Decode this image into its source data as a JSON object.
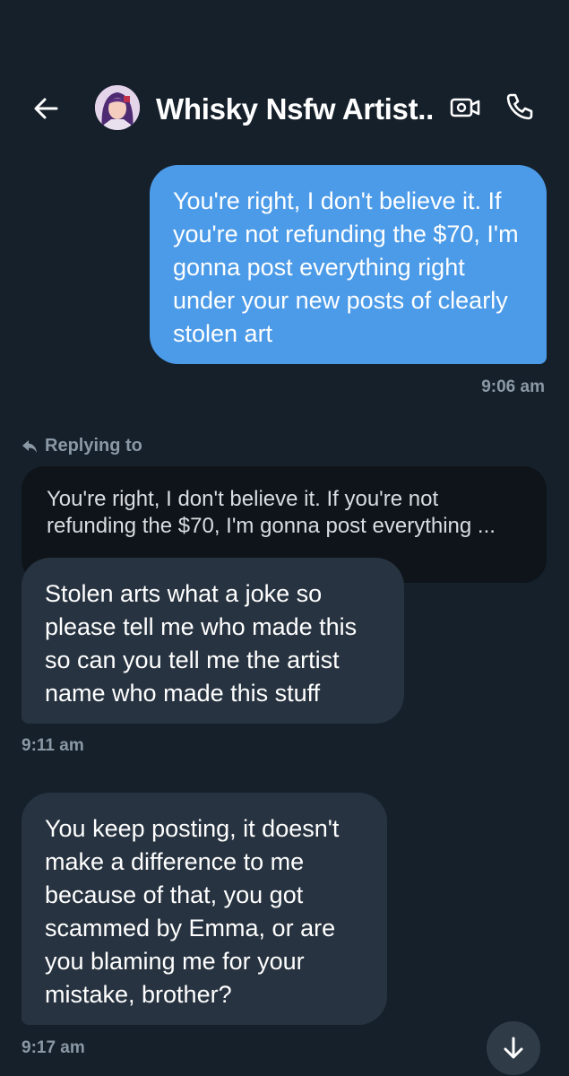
{
  "header": {
    "contact_name": "Whisky Nsfw Artist...",
    "back_icon": "arrow-left-icon",
    "video_icon": "video-camera-icon",
    "call_icon": "phone-icon"
  },
  "messages": {
    "outgoing_1": {
      "text": "You're right, I don't believe it. If you're not refunding the $70, I'm gonna post everything right under your new posts of clearly stolen art",
      "time": "9:06 am"
    },
    "reply": {
      "label": "Replying to",
      "quote_line_1": "You're right, I don't believe it. If you're not",
      "quote_line_2": "refunding the $70, I'm gonna post everything ..."
    },
    "incoming_1": {
      "text": "Stolen arts what a joke so please tell me who made this so can you tell me the artist name who made this stuff",
      "time": "9:11 am"
    },
    "incoming_2": {
      "text": "You keep posting, it doesn't make a difference to me because of that, you got scammed by Emma, or are you blaming me for your mistake, brother?",
      "time": "9:17 am"
    }
  },
  "scroll_down_icon": "arrow-down-icon",
  "colors": {
    "background": "#15202b",
    "outgoing_bubble": "#4c9be8",
    "incoming_bubble": "#273340",
    "quote_box": "#0e1419",
    "muted_text": "#8b98a5"
  }
}
